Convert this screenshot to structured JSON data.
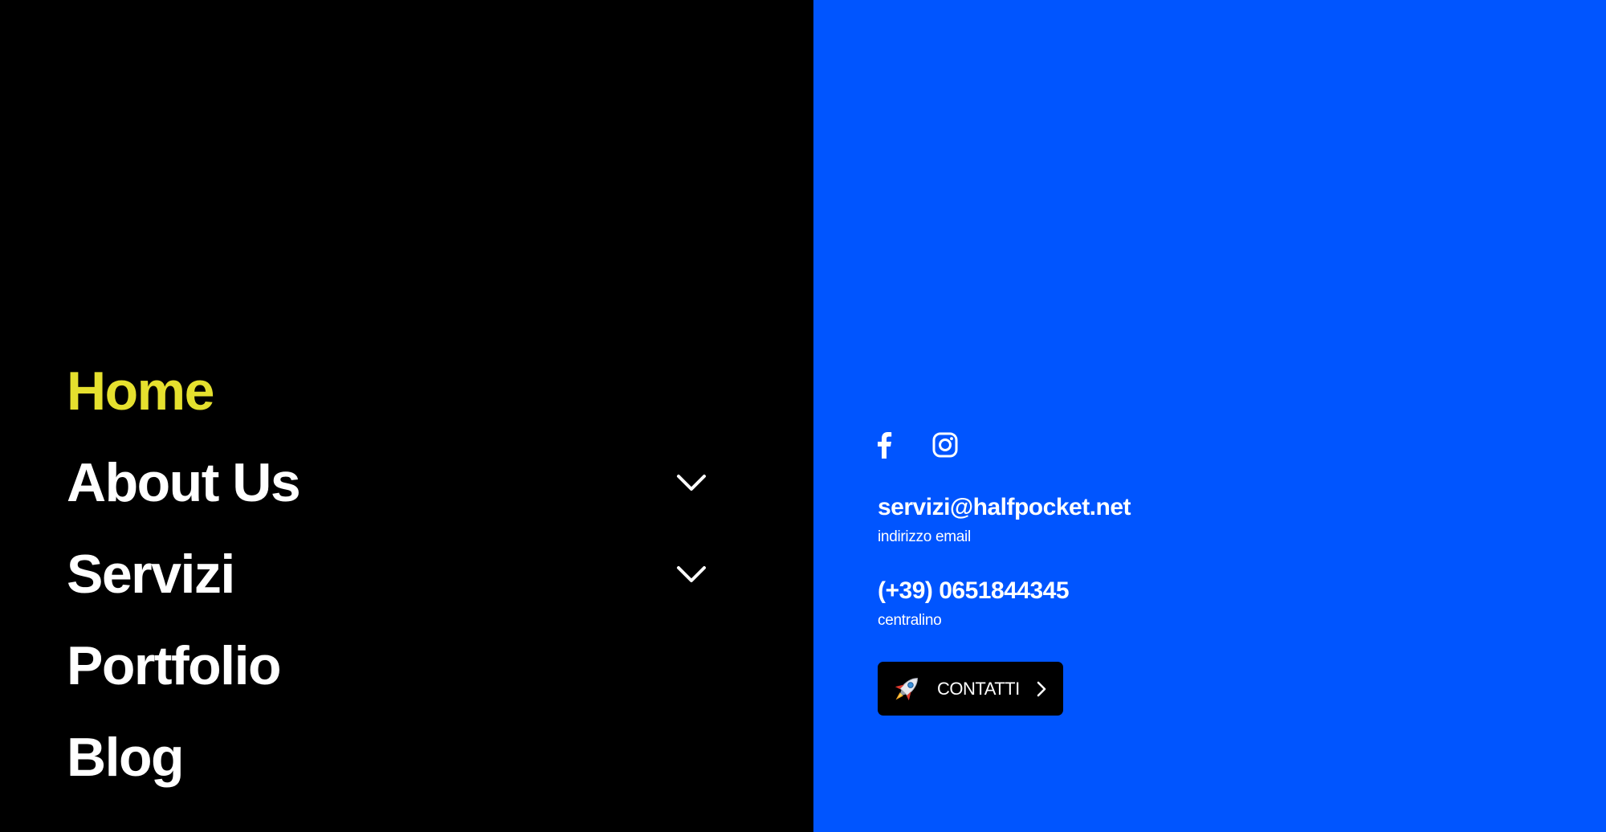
{
  "nav": {
    "items": [
      {
        "label": "Home",
        "active": true,
        "has_submenu": false
      },
      {
        "label": "About Us",
        "active": false,
        "has_submenu": true
      },
      {
        "label": "Servizi",
        "active": false,
        "has_submenu": true
      },
      {
        "label": "Portfolio",
        "active": false,
        "has_submenu": false
      },
      {
        "label": "Blog",
        "active": false,
        "has_submenu": false
      }
    ],
    "active_color": "#e5e02e",
    "text_color": "#ffffff",
    "background": "#000000"
  },
  "contact": {
    "background": "#0055ff",
    "social": [
      {
        "icon": "facebook-icon"
      },
      {
        "icon": "instagram-icon"
      }
    ],
    "email": {
      "value": "servizi@halfpocket.net",
      "caption": "indirizzo email"
    },
    "phone": {
      "value": "(+39) 0651844345",
      "caption": "centralino"
    },
    "cta": {
      "label": "CONTATTI",
      "icon": "rocket-icon",
      "arrow_icon": "chevron-right-icon"
    }
  }
}
